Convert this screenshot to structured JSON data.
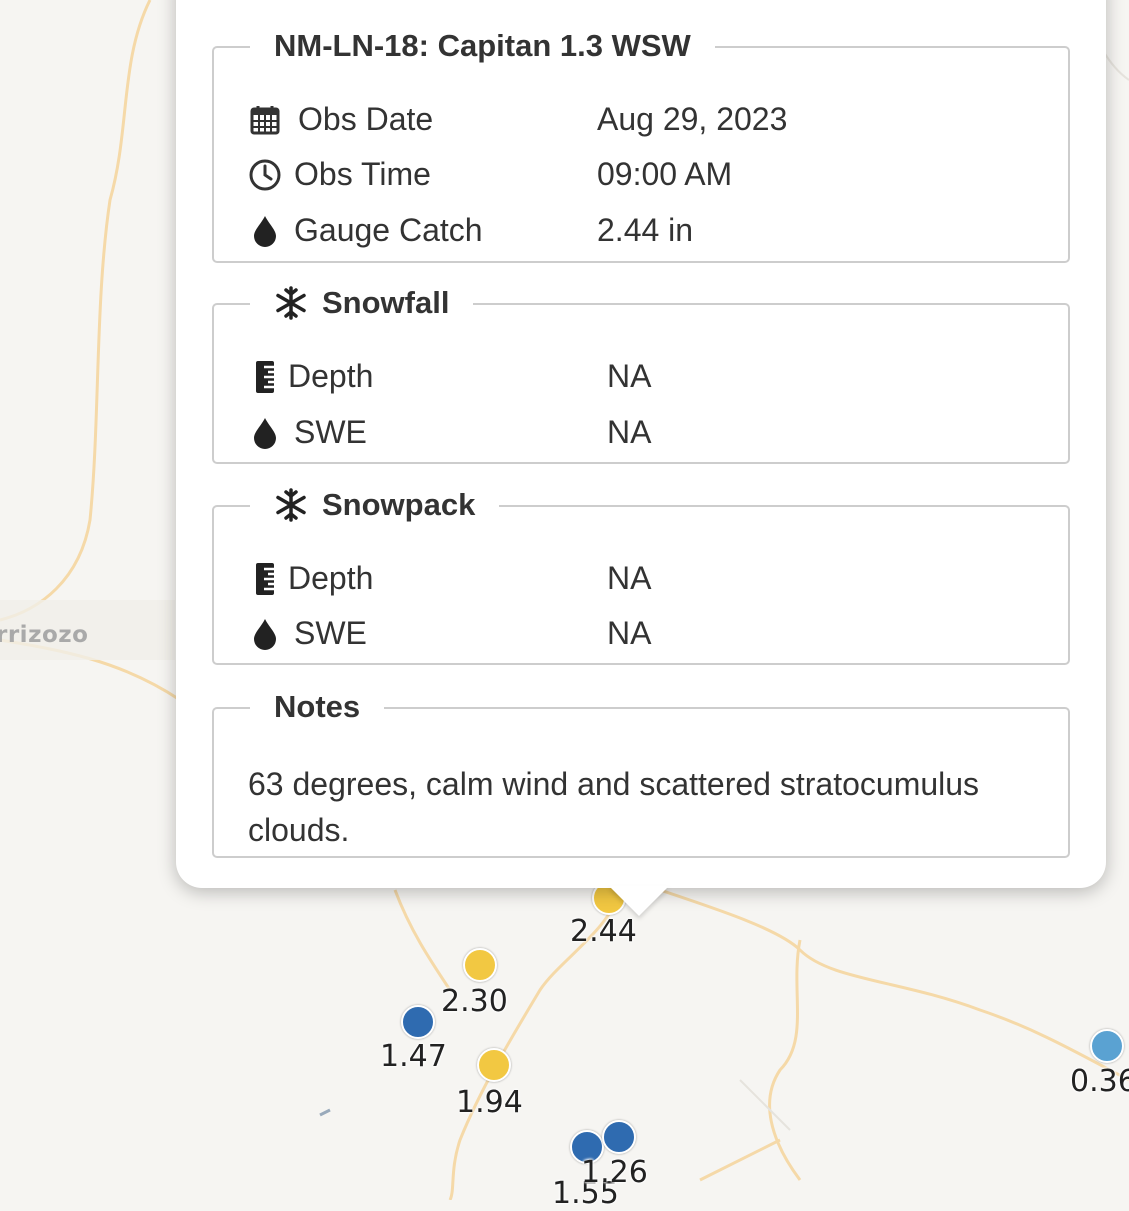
{
  "map": {
    "place_label": "rrizozo",
    "markers": [
      {
        "label": "2.44",
        "color": "#f2c842"
      },
      {
        "label": "2.30",
        "color": "#f2c842"
      },
      {
        "label": "1.47",
        "color": "#2f6bb0"
      },
      {
        "label": "1.94",
        "color": "#f2c842"
      },
      {
        "label": "1.26",
        "color": "#2f6bb0"
      },
      {
        "label": "1.55",
        "color": "#2f6bb0"
      },
      {
        "label": "0.36",
        "color": "#5aa2d2"
      }
    ]
  },
  "popup": {
    "station_title": "NM-LN-18: Capitan 1.3 WSW",
    "obs": {
      "date_label": "Obs Date",
      "date_value": "Aug 29, 2023",
      "time_label": "Obs Time",
      "time_value": "09:00 AM",
      "catch_label": "Gauge Catch",
      "catch_value": "2.44 in"
    },
    "snowfall": {
      "title": "Snowfall",
      "depth_label": "Depth",
      "depth_value": "NA",
      "swe_label": "SWE",
      "swe_value": "NA"
    },
    "snowpack": {
      "title": "Snowpack",
      "depth_label": "Depth",
      "depth_value": "NA",
      "swe_label": "SWE",
      "swe_value": "NA"
    },
    "notes": {
      "title": "Notes",
      "text": "63 degrees, calm wind and scattered stratocumulus clouds."
    }
  },
  "colors": {
    "marker_yellow": "#f2c842",
    "marker_blue": "#2f6bb0",
    "marker_lightblue": "#5aa2d2",
    "road": "#f5d9a8",
    "fieldset_border": "#cdcdcd"
  }
}
